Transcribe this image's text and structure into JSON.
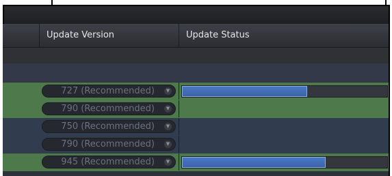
{
  "table": {
    "headers": [
      "Update Version",
      "Update Status"
    ],
    "rows": [
      {
        "version": "727 (Recommended)",
        "progress": 0.61,
        "highlight": true
      },
      {
        "version": "790 (Recommended)",
        "progress": null,
        "highlight": true
      },
      {
        "version": "750 (Recommended)",
        "progress": null,
        "highlight": false
      },
      {
        "version": "790 (Recommended)",
        "progress": null,
        "highlight": false
      },
      {
        "version": "945 (Recommended)",
        "progress": 0.7,
        "highlight": true
      }
    ]
  },
  "colors": {
    "highlight": "#4e7a4b",
    "row": "#323c4f",
    "fill": "#4a79c4"
  }
}
